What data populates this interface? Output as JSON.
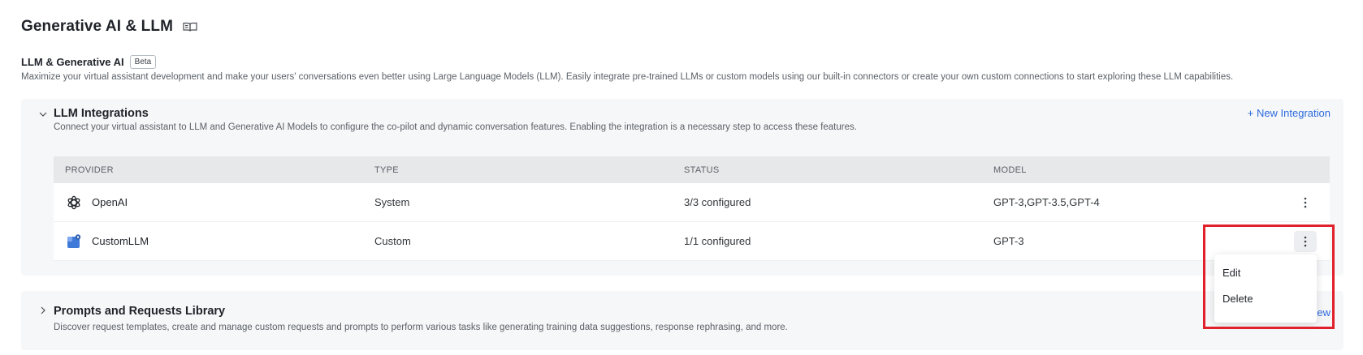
{
  "page": {
    "title": "Generative AI & LLM",
    "icon": "book-open-icon"
  },
  "section": {
    "title": "LLM & Generative AI",
    "badge": "Beta",
    "description": "Maximize your virtual assistant development and make your users' conversations even better using Large Language Models (LLM). Easily integrate pre-trained LLMs or custom models using our built-in connectors or create your own custom connections to start exploring these LLM capabilities."
  },
  "integrations": {
    "title": "LLM Integrations",
    "description": "Connect your virtual assistant to LLM and Generative AI Models to configure the co-pilot and dynamic conversation features. Enabling the integration is a necessary step to access these features.",
    "action": "+ New Integration",
    "expanded": true,
    "columns": [
      "PROVIDER",
      "TYPE",
      "STATUS",
      "MODEL"
    ],
    "rows": [
      {
        "provider": "OpenAI",
        "icon": "openai-logo-icon",
        "type": "System",
        "status": "3/3 configured",
        "model": "GPT-3,GPT-3.5,GPT-4"
      },
      {
        "provider": "CustomLLM",
        "icon": "custom-llm-icon",
        "type": "Custom",
        "status": "1/1 configured",
        "model": "GPT-3"
      }
    ]
  },
  "menu": {
    "items": [
      "Edit",
      "Delete"
    ]
  },
  "library": {
    "title": "Prompts and Requests Library",
    "description": "Discover request templates, create and manage custom requests and prompts to perform various tasks like generating training data suggestions, response rephrasing, and more.",
    "action": "+ Add New",
    "expanded": false
  },
  "colors": {
    "accent": "#2e6bde",
    "highlight": "#e0202a",
    "panel_bg": "#f6f7f8",
    "header_bg": "#e7e8ea"
  }
}
